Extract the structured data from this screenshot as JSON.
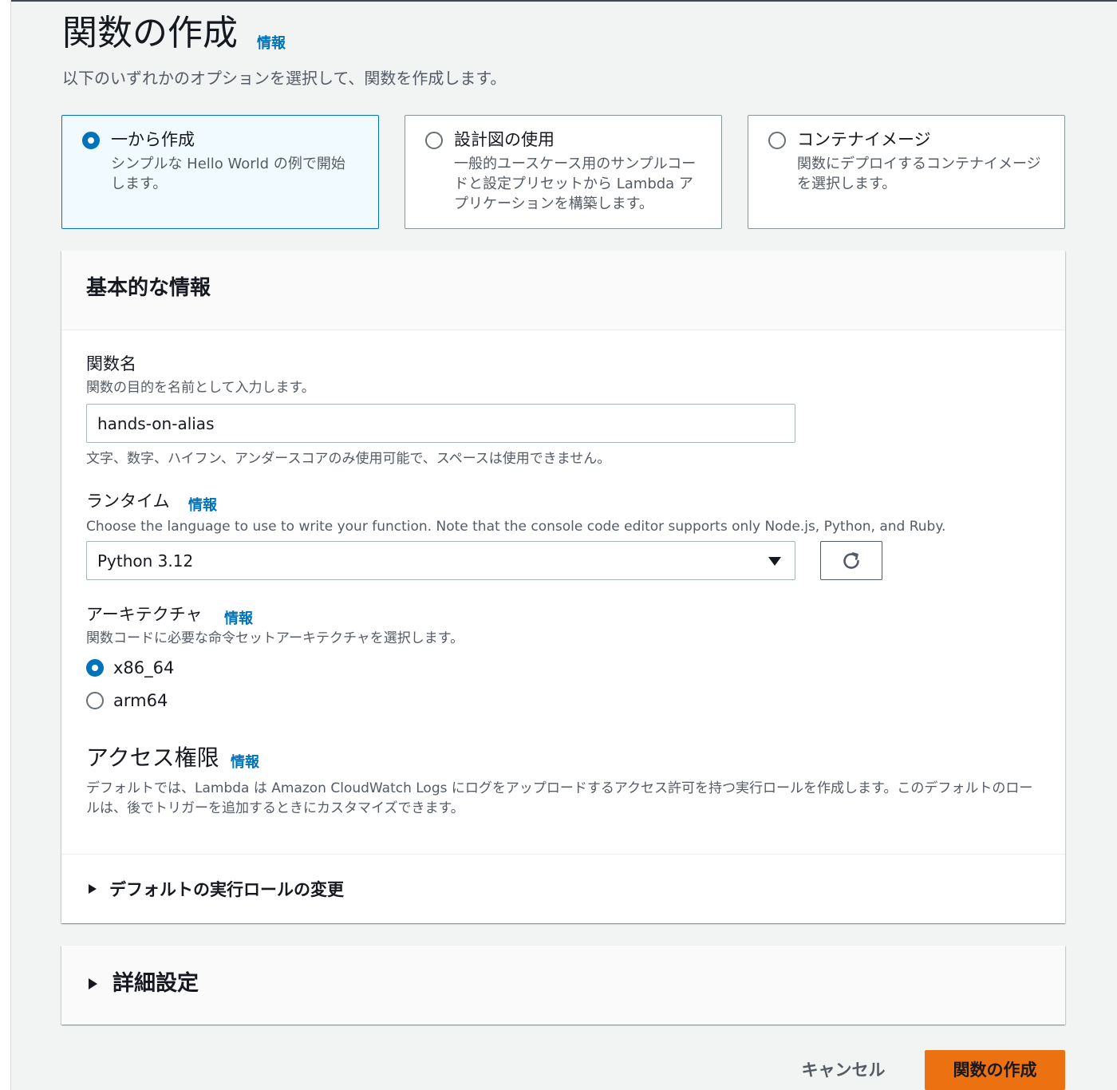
{
  "page": {
    "title": "関数の作成",
    "info_label": "情報",
    "description": "以下のいずれかのオプションを選択して、関数を作成します。"
  },
  "options": [
    {
      "title": "一から作成",
      "description": "シンプルな Hello World の例で開始します。",
      "selected": true
    },
    {
      "title": "設計図の使用",
      "description": "一般的ユースケース用のサンプルコードと設定プリセットから Lambda アプリケーションを構築します。",
      "selected": false
    },
    {
      "title": "コンテナイメージ",
      "description": "関数にデプロイするコンテナイメージを選択します。",
      "selected": false
    }
  ],
  "basic_info": {
    "header": "基本的な情報",
    "function_name": {
      "label": "関数名",
      "description": "関数の目的を名前として入力します。",
      "value": "hands-on-alias",
      "hint": "文字、数字、ハイフン、アンダースコアのみ使用可能で、スペースは使用できません。"
    },
    "runtime": {
      "label": "ランタイム",
      "info_label": "情報",
      "description": "Choose the language to use to write your function. Note that the console code editor supports only Node.js, Python, and Ruby.",
      "selected": "Python 3.12",
      "refresh_icon": "refresh-icon"
    },
    "architecture": {
      "label": "アーキテクチャ",
      "info_label": "情報",
      "description": "関数コードに必要な命令セットアーキテクチャを選択します。",
      "choices": [
        {
          "label": "x86_64",
          "checked": true
        },
        {
          "label": "arm64",
          "checked": false
        }
      ]
    },
    "permissions": {
      "title": "アクセス権限",
      "info_label": "情報",
      "description": "デフォルトでは、Lambda は Amazon CloudWatch Logs にログをアップロードするアクセス許可を持つ実行ロールを作成します。このデフォルトのロールは、後でトリガーを追加するときにカスタマイズできます。",
      "expander": "デフォルトの実行ロールの変更"
    }
  },
  "advanced": {
    "title": "詳細設定"
  },
  "footer": {
    "cancel_label": "キャンセル",
    "create_label": "関数の作成"
  },
  "colors": {
    "accent": "#0073bb",
    "primary_button": "#ec7211",
    "selected_card_bg": "#f1faff",
    "page_bg": "#f2f3f3"
  }
}
